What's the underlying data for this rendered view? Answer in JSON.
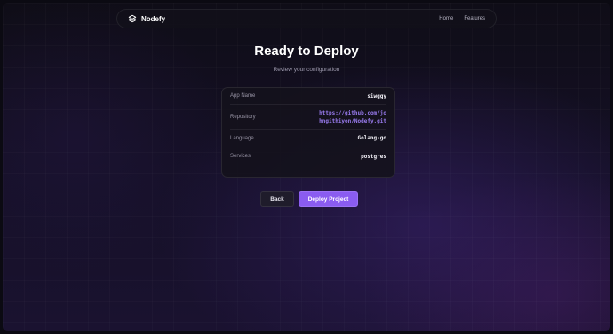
{
  "navbar": {
    "brand_name": "Nodefy",
    "brand_icon": "layers-icon",
    "links": [
      {
        "label": "Home"
      },
      {
        "label": "Features"
      }
    ]
  },
  "page": {
    "title": "Ready to Deploy",
    "subtitle": "Review your configuration"
  },
  "config": {
    "rows": [
      {
        "label": "App Name",
        "value": "siwggy"
      },
      {
        "label": "Repository",
        "value": "https://github.com/johngithiyon/Nodefy.git"
      },
      {
        "label": "Language",
        "value": "Golang-go"
      },
      {
        "label": "Services",
        "value": "postgres"
      }
    ]
  },
  "actions": {
    "back_label": "Back",
    "deploy_label": "Deploy Project"
  },
  "colors": {
    "accent": "#8a5cf0",
    "link": "#9a7cf0",
    "background": "#0f0d17"
  }
}
